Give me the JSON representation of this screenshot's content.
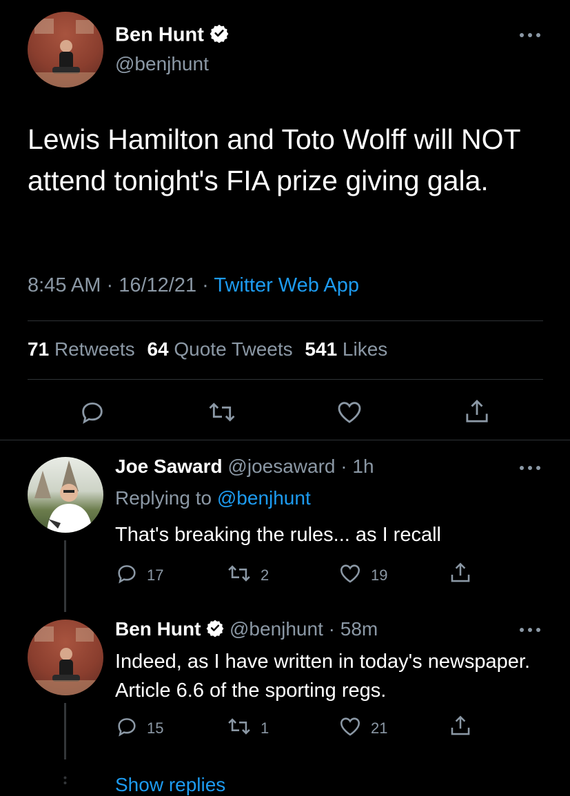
{
  "main_tweet": {
    "author_name": "Ben Hunt",
    "author_handle": "@benjhunt",
    "text": "Lewis Hamilton and Toto Wolff will NOT attend tonight's FIA prize giving gala.",
    "time": "8:45 AM",
    "date": "16/12/21",
    "source": "Twitter Web App",
    "retweets_count": "71",
    "retweets_label": "Retweets",
    "quotes_count": "64",
    "quotes_label": "Quote Tweets",
    "likes_count": "541",
    "likes_label": "Likes"
  },
  "replies": [
    {
      "author_name": "Joe Saward",
      "author_handle": "@joesaward",
      "age": "1h",
      "replying_label": "Replying to",
      "replying_to": "@benjhunt",
      "text": "That's breaking the rules... as I recall",
      "reply_count": "17",
      "retweet_count": "2",
      "like_count": "19"
    },
    {
      "author_name": "Ben Hunt",
      "author_handle": "@benjhunt",
      "age": "58m",
      "text": "Indeed, as I have written in today's newspaper. Article 6.6 of the sporting regs.",
      "reply_count": "15",
      "retweet_count": "1",
      "like_count": "21"
    }
  ],
  "show_replies": "Show replies",
  "colors": {
    "accent": "#1d9bf0",
    "muted": "#8b98a5",
    "background": "#000000",
    "divider": "#2f3336"
  },
  "icons": [
    "verified-icon",
    "more-icon",
    "reply-icon",
    "retweet-icon",
    "like-icon",
    "share-icon"
  ]
}
